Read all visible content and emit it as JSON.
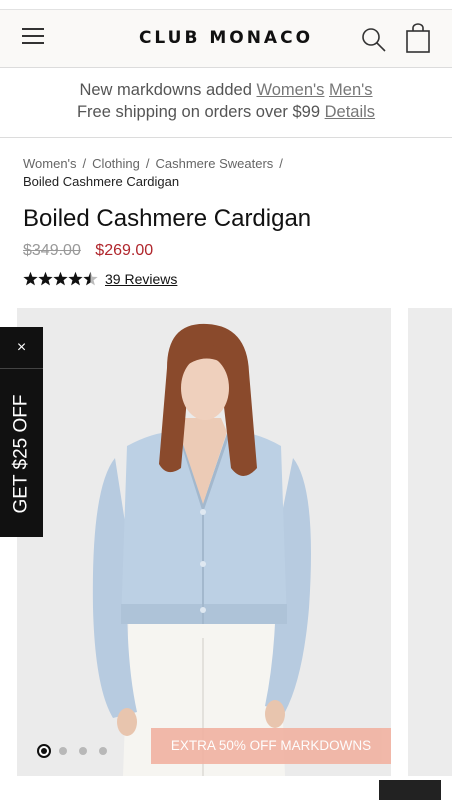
{
  "header": {
    "logo": "CLUB MONACO",
    "menu_icon": "hamburger-menu-icon",
    "search_icon": "search-icon",
    "bag_icon": "shopping-bag-icon"
  },
  "promo": {
    "line1_text": "New markdowns added",
    "line1_link_women": "Women's",
    "line1_link_men": "Men's",
    "line2_text": "Free shipping on orders over $99",
    "line2_link": "Details"
  },
  "breadcrumb": {
    "items": [
      "Women's",
      "Clothing",
      "Cashmere Sweaters"
    ],
    "separator": "/",
    "current": "Boiled Cashmere Cardigan"
  },
  "product": {
    "title": "Boiled Cashmere Cardigan",
    "original_price": "$349.00",
    "sale_price": "$269.00",
    "rating": 4.5,
    "rating_max": 5,
    "reviews_label": "39 Reviews"
  },
  "gallery": {
    "image_count": 4,
    "active_index": 0,
    "banner": "EXTRA 50% OFF MARKDOWNS"
  },
  "side_tab": {
    "close_label": "×",
    "offer_label": "GET $25 OFF"
  },
  "colors": {
    "sale_red": "#b0262c",
    "banner_peach": "#f1b3a3",
    "sweater_blue": "#b7cbe0",
    "tab_black": "#111111"
  }
}
